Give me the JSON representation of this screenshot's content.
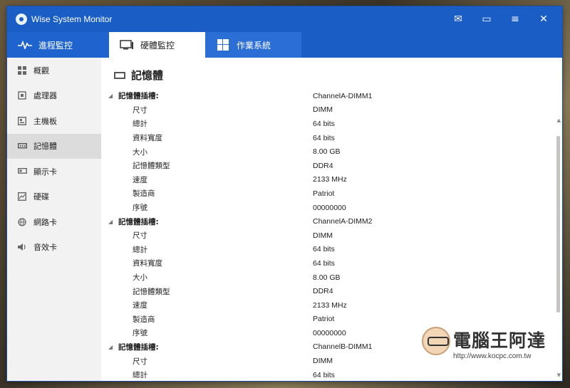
{
  "window": {
    "title": "Wise System Monitor",
    "controls": [
      "✉",
      "▭",
      "≡",
      "✕"
    ]
  },
  "tabs": [
    {
      "label": "進程監控",
      "icon": "pulse-icon"
    },
    {
      "label": "硬體監控",
      "icon": "monitor-icon"
    },
    {
      "label": "作業系統",
      "icon": "windows-icon"
    }
  ],
  "sidebar": {
    "items": [
      {
        "label": "概觀",
        "icon": "grid-icon"
      },
      {
        "label": "處理器",
        "icon": "cpu-icon"
      },
      {
        "label": "主機板",
        "icon": "motherboard-icon"
      },
      {
        "label": "記憶體",
        "icon": "memory-icon"
      },
      {
        "label": "顯示卡",
        "icon": "gpu-icon"
      },
      {
        "label": "硬碟",
        "icon": "disk-icon"
      },
      {
        "label": "網路卡",
        "icon": "globe-icon"
      },
      {
        "label": "音效卡",
        "icon": "speaker-icon"
      }
    ],
    "active_index": 3
  },
  "main": {
    "section_title": "記憶體",
    "rows": [
      {
        "type": "group",
        "key": "記憶體插槽:",
        "value": "ChannelA-DIMM1"
      },
      {
        "type": "child",
        "key": "尺寸",
        "value": "DIMM"
      },
      {
        "type": "child",
        "key": "總計",
        "value": "64 bits"
      },
      {
        "type": "child",
        "key": "資料寬度",
        "value": "64 bits"
      },
      {
        "type": "child",
        "key": "大小",
        "value": "8.00 GB"
      },
      {
        "type": "child",
        "key": "記憶體類型",
        "value": "DDR4"
      },
      {
        "type": "child",
        "key": "速度",
        "value": "2133 MHz"
      },
      {
        "type": "child",
        "key": "製造商",
        "value": "Patriot"
      },
      {
        "type": "child",
        "key": "序號",
        "value": "00000000"
      },
      {
        "type": "group",
        "key": "記憶體插槽:",
        "value": "ChannelA-DIMM2"
      },
      {
        "type": "child",
        "key": "尺寸",
        "value": "DIMM"
      },
      {
        "type": "child",
        "key": "總計",
        "value": "64 bits"
      },
      {
        "type": "child",
        "key": "資料寬度",
        "value": "64 bits"
      },
      {
        "type": "child",
        "key": "大小",
        "value": "8.00 GB"
      },
      {
        "type": "child",
        "key": "記憶體類型",
        "value": "DDR4"
      },
      {
        "type": "child",
        "key": "速度",
        "value": "2133 MHz"
      },
      {
        "type": "child",
        "key": "製造商",
        "value": "Patriot"
      },
      {
        "type": "child",
        "key": "序號",
        "value": "00000000"
      },
      {
        "type": "group",
        "key": "記憶體插槽:",
        "value": "ChannelB-DIMM1"
      },
      {
        "type": "child",
        "key": "尺寸",
        "value": "DIMM"
      },
      {
        "type": "child",
        "key": "總計",
        "value": "64 bits"
      }
    ]
  },
  "watermark": {
    "text": "電腦王阿達",
    "url": "http://www.kocpc.com.tw"
  },
  "colors": {
    "accent": "#1a5dc5",
    "sidebar_bg": "#f2f2f2",
    "sidebar_active": "#dcdcdc"
  }
}
